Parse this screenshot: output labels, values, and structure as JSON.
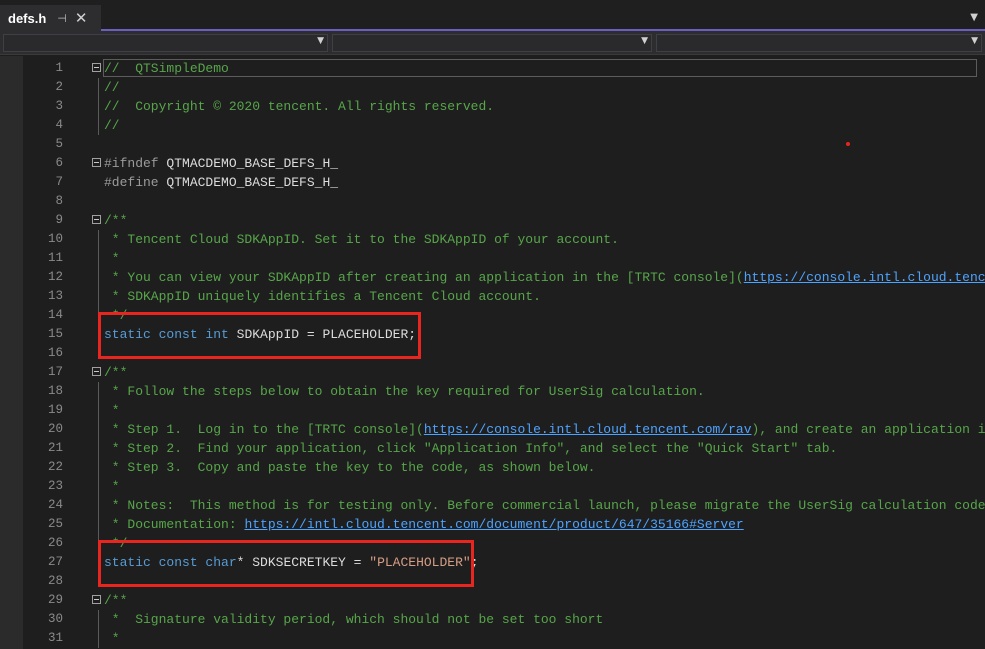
{
  "tab": {
    "title": "defs.h",
    "pin_icon": "pin-icon",
    "close_icon": "close-icon"
  },
  "code_lines": [
    {
      "n": "1",
      "fold": true,
      "segments": [
        {
          "t": "//  QTSimpleDemo",
          "c": "comment"
        }
      ]
    },
    {
      "n": "2",
      "guide": true,
      "segments": [
        {
          "t": "//",
          "c": "comment"
        }
      ]
    },
    {
      "n": "3",
      "guide": true,
      "segments": [
        {
          "t": "//  Copyright © 2020 tencent. All rights reserved.",
          "c": "comment"
        }
      ]
    },
    {
      "n": "4",
      "guide": true,
      "segments": [
        {
          "t": "//",
          "c": "comment"
        }
      ]
    },
    {
      "n": "5",
      "segments": []
    },
    {
      "n": "6",
      "fold": true,
      "segments": [
        {
          "t": "#ifndef ",
          "c": "pp"
        },
        {
          "t": "QTMACDEMO_BASE_DEFS_H_",
          "c": "plain"
        }
      ]
    },
    {
      "n": "7",
      "segments": [
        {
          "t": "#define ",
          "c": "pp"
        },
        {
          "t": "QTMACDEMO_BASE_DEFS_H_",
          "c": "plain"
        }
      ]
    },
    {
      "n": "8",
      "segments": []
    },
    {
      "n": "9",
      "fold": true,
      "segments": [
        {
          "t": "/**",
          "c": "comment"
        }
      ]
    },
    {
      "n": "10",
      "guide": true,
      "segments": [
        {
          "t": " * Tencent Cloud SDKAppID. Set it to the SDKAppID of your account.",
          "c": "comment"
        }
      ]
    },
    {
      "n": "11",
      "guide": true,
      "segments": [
        {
          "t": " *",
          "c": "comment"
        }
      ]
    },
    {
      "n": "12",
      "guide": true,
      "segments": [
        {
          "t": " * You can view your SDKAppID after creating an application in the [TRTC console](",
          "c": "comment"
        },
        {
          "t": "https://console.intl.cloud.tencent.",
          "c": "link"
        }
      ]
    },
    {
      "n": "13",
      "guide": true,
      "segments": [
        {
          "t": " * SDKAppID uniquely identifies a Tencent Cloud account.",
          "c": "comment"
        }
      ]
    },
    {
      "n": "14",
      "guide": true,
      "segments": [
        {
          "t": " */",
          "c": "comment"
        }
      ]
    },
    {
      "n": "15",
      "segments": [
        {
          "t": "static ",
          "c": "kw"
        },
        {
          "t": "const ",
          "c": "kw"
        },
        {
          "t": "int ",
          "c": "kw"
        },
        {
          "t": "SDKAppID = PLACEHOLDER;",
          "c": "plain"
        }
      ]
    },
    {
      "n": "16",
      "segments": []
    },
    {
      "n": "17",
      "fold": true,
      "segments": [
        {
          "t": "/**",
          "c": "comment"
        }
      ]
    },
    {
      "n": "18",
      "guide": true,
      "segments": [
        {
          "t": " * Follow the steps below to obtain the key required for UserSig calculation.",
          "c": "comment"
        }
      ]
    },
    {
      "n": "19",
      "guide": true,
      "segments": [
        {
          "t": " *",
          "c": "comment"
        }
      ]
    },
    {
      "n": "20",
      "guide": true,
      "segments": [
        {
          "t": " * Step 1.  Log in to the [TRTC console](",
          "c": "comment"
        },
        {
          "t": "https://console.intl.cloud.tencent.com/rav",
          "c": "link"
        },
        {
          "t": "), and create an application if yo",
          "c": "comment"
        }
      ]
    },
    {
      "n": "21",
      "guide": true,
      "segments": [
        {
          "t": " * Step 2.  Find your application, click \"Application Info\", and select the \"Quick Start\" tab.",
          "c": "comment"
        }
      ]
    },
    {
      "n": "22",
      "guide": true,
      "segments": [
        {
          "t": " * Step 3.  Copy and paste the key to the code, as shown below.",
          "c": "comment"
        }
      ]
    },
    {
      "n": "23",
      "guide": true,
      "segments": [
        {
          "t": " *",
          "c": "comment"
        }
      ]
    },
    {
      "n": "24",
      "guide": true,
      "segments": [
        {
          "t": " * Notes:  This method is for testing only. Before commercial launch, please migrate the UserSig calculation code and",
          "c": "comment"
        }
      ]
    },
    {
      "n": "25",
      "guide": true,
      "segments": [
        {
          "t": " * Documentation: ",
          "c": "comment"
        },
        {
          "t": "https://intl.cloud.tencent.com/document/product/647/35166#Server",
          "c": "link"
        }
      ]
    },
    {
      "n": "26",
      "guide": true,
      "segments": [
        {
          "t": " */",
          "c": "comment"
        }
      ]
    },
    {
      "n": "27",
      "segments": [
        {
          "t": "static ",
          "c": "kw"
        },
        {
          "t": "const ",
          "c": "kw"
        },
        {
          "t": "char",
          "c": "kw"
        },
        {
          "t": "* SDKSECRETKEY = ",
          "c": "plain"
        },
        {
          "t": "\"PLACEHOLDER\"",
          "c": "str"
        },
        {
          "t": ";",
          "c": "plain"
        }
      ]
    },
    {
      "n": "28",
      "segments": []
    },
    {
      "n": "29",
      "fold": true,
      "segments": [
        {
          "t": "/**",
          "c": "comment"
        }
      ]
    },
    {
      "n": "30",
      "guide": true,
      "segments": [
        {
          "t": " *  Signature validity period, which should not be set too short",
          "c": "comment"
        }
      ]
    },
    {
      "n": "31",
      "guide": true,
      "segments": [
        {
          "t": " *",
          "c": "comment"
        }
      ]
    }
  ],
  "colors": {
    "accent": "#6b5fbf",
    "highlight": "#e8261f",
    "comment": "#57a64a",
    "keyword": "#569cd6",
    "string": "#d69d85",
    "link": "#4ea3ff"
  }
}
